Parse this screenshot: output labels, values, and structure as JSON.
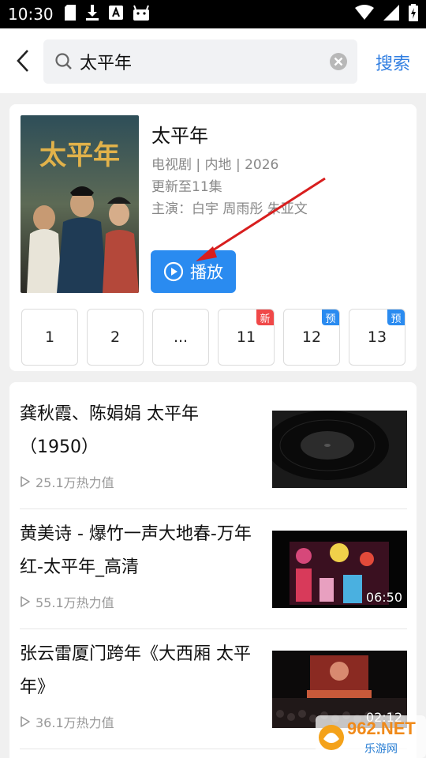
{
  "status_bar": {
    "time": "10:30"
  },
  "search": {
    "query": "太平年",
    "action_label": "搜索"
  },
  "show": {
    "title": "太平年",
    "meta": "电视剧 | 内地 | 2026",
    "update": "更新至11集",
    "cast": "主演：白宇 周雨彤 朱亚文",
    "play_label": "播放",
    "poster_text": "太平年",
    "episodes": [
      {
        "label": "1",
        "tag": ""
      },
      {
        "label": "2",
        "tag": ""
      },
      {
        "label": "...",
        "tag": ""
      },
      {
        "label": "11",
        "tag": "新"
      },
      {
        "label": "12",
        "tag": "预"
      },
      {
        "label": "13",
        "tag": "预"
      }
    ]
  },
  "results": [
    {
      "title": "龚秋霞、陈娟娟 太平年（1950）",
      "heat": "25.1万热力值",
      "duration": ""
    },
    {
      "title": "黄美诗 - 爆竹一声大地春-万年红-太平年_高清",
      "heat": "55.1万热力值",
      "duration": "06:50"
    },
    {
      "title": "张云雷厦门跨年《大西厢 太平年》",
      "heat": "36.1万热力值",
      "duration": "02:12"
    }
  ],
  "watermark": {
    "main": "962.NET",
    "sub": "乐游网"
  },
  "colors": {
    "accent": "#2a8bf0",
    "new_tag": "#f04848",
    "link": "#2f7de1"
  }
}
